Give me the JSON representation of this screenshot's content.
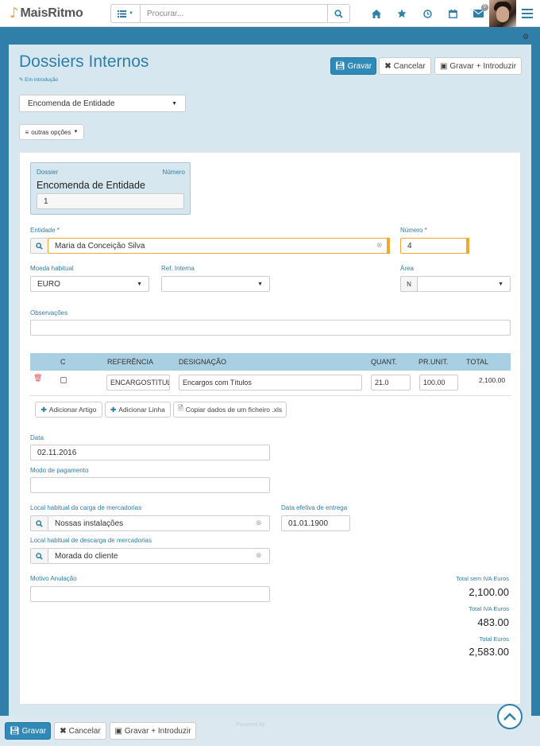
{
  "app": {
    "name": "MaisRitmo"
  },
  "search": {
    "placeholder": "Procurar..."
  },
  "notifications": {
    "count": "0"
  },
  "page": {
    "title": "Dossiers Internos",
    "status": "Em introdução"
  },
  "actions": {
    "save": "Gravar",
    "cancel": "Cancelar",
    "save_new": "Gravar + Introduzir"
  },
  "type_select": {
    "value": "Encomenda de Entidade"
  },
  "more_options": "outras opções",
  "dossier": {
    "label": "Dossier",
    "number_label": "Número",
    "name": "Encomenda de Entidade",
    "value": "1"
  },
  "form": {
    "entidade": {
      "label": "Entidade *",
      "value": "Maria da Conceição Silva"
    },
    "numero": {
      "label": "Número *",
      "value": "4"
    },
    "moeda": {
      "label": "Moeda habitual",
      "value": "EURO"
    },
    "ref_interna": {
      "label": "Ref. Interna",
      "value": ""
    },
    "area": {
      "label": "Área",
      "prefix": "N",
      "value": ""
    },
    "observacoes": {
      "label": "Observações",
      "value": ""
    },
    "data": {
      "label": "Data",
      "value": "02.11.2016"
    },
    "modo_pagamento": {
      "label": "Modo de pagamento",
      "value": ""
    },
    "local_carga": {
      "label": "Local habitual da carga de mercadorias",
      "value": "Nossas instalações"
    },
    "data_entrega": {
      "label": "Data efetiva de entrega",
      "value": "01.01.1900"
    },
    "local_descarga": {
      "label": "Local habitual de descarga de mercadorias",
      "value": "Morada do cliente"
    },
    "motivo": {
      "label": "Motivo Anulação",
      "value": ""
    }
  },
  "table": {
    "headers": [
      "C",
      "REFERÊNCIA",
      "DESIGNAÇÃO",
      "QUANT.",
      "PR.UNIT.",
      "TOTAL"
    ],
    "rows": [
      {
        "ref": "ENCARGOSTITUL",
        "designacao": "Encargos com Títulos",
        "quant": "21.0",
        "pr_unit": "100.00",
        "total": "2,100.00"
      }
    ]
  },
  "line_buttons": {
    "add_article": "Adicionar Artigo",
    "add_line": "Adicionar Linha",
    "copy_file": "Copiar dados de um ficheiro .xls"
  },
  "totals": {
    "sem_iva_label": "Total sem IVA Euros",
    "sem_iva": "2,100.00",
    "iva_label": "Total IVA Euros",
    "iva": "483.00",
    "total_label": "Total Euros",
    "total": "2,583.00"
  },
  "footer": {
    "powered": "Powered by"
  },
  "colors": {
    "accent": "#2f7fa8",
    "primary_button": "#2f8ab8",
    "highlight": "#f0a830",
    "table_header": "#a9cfe3"
  }
}
